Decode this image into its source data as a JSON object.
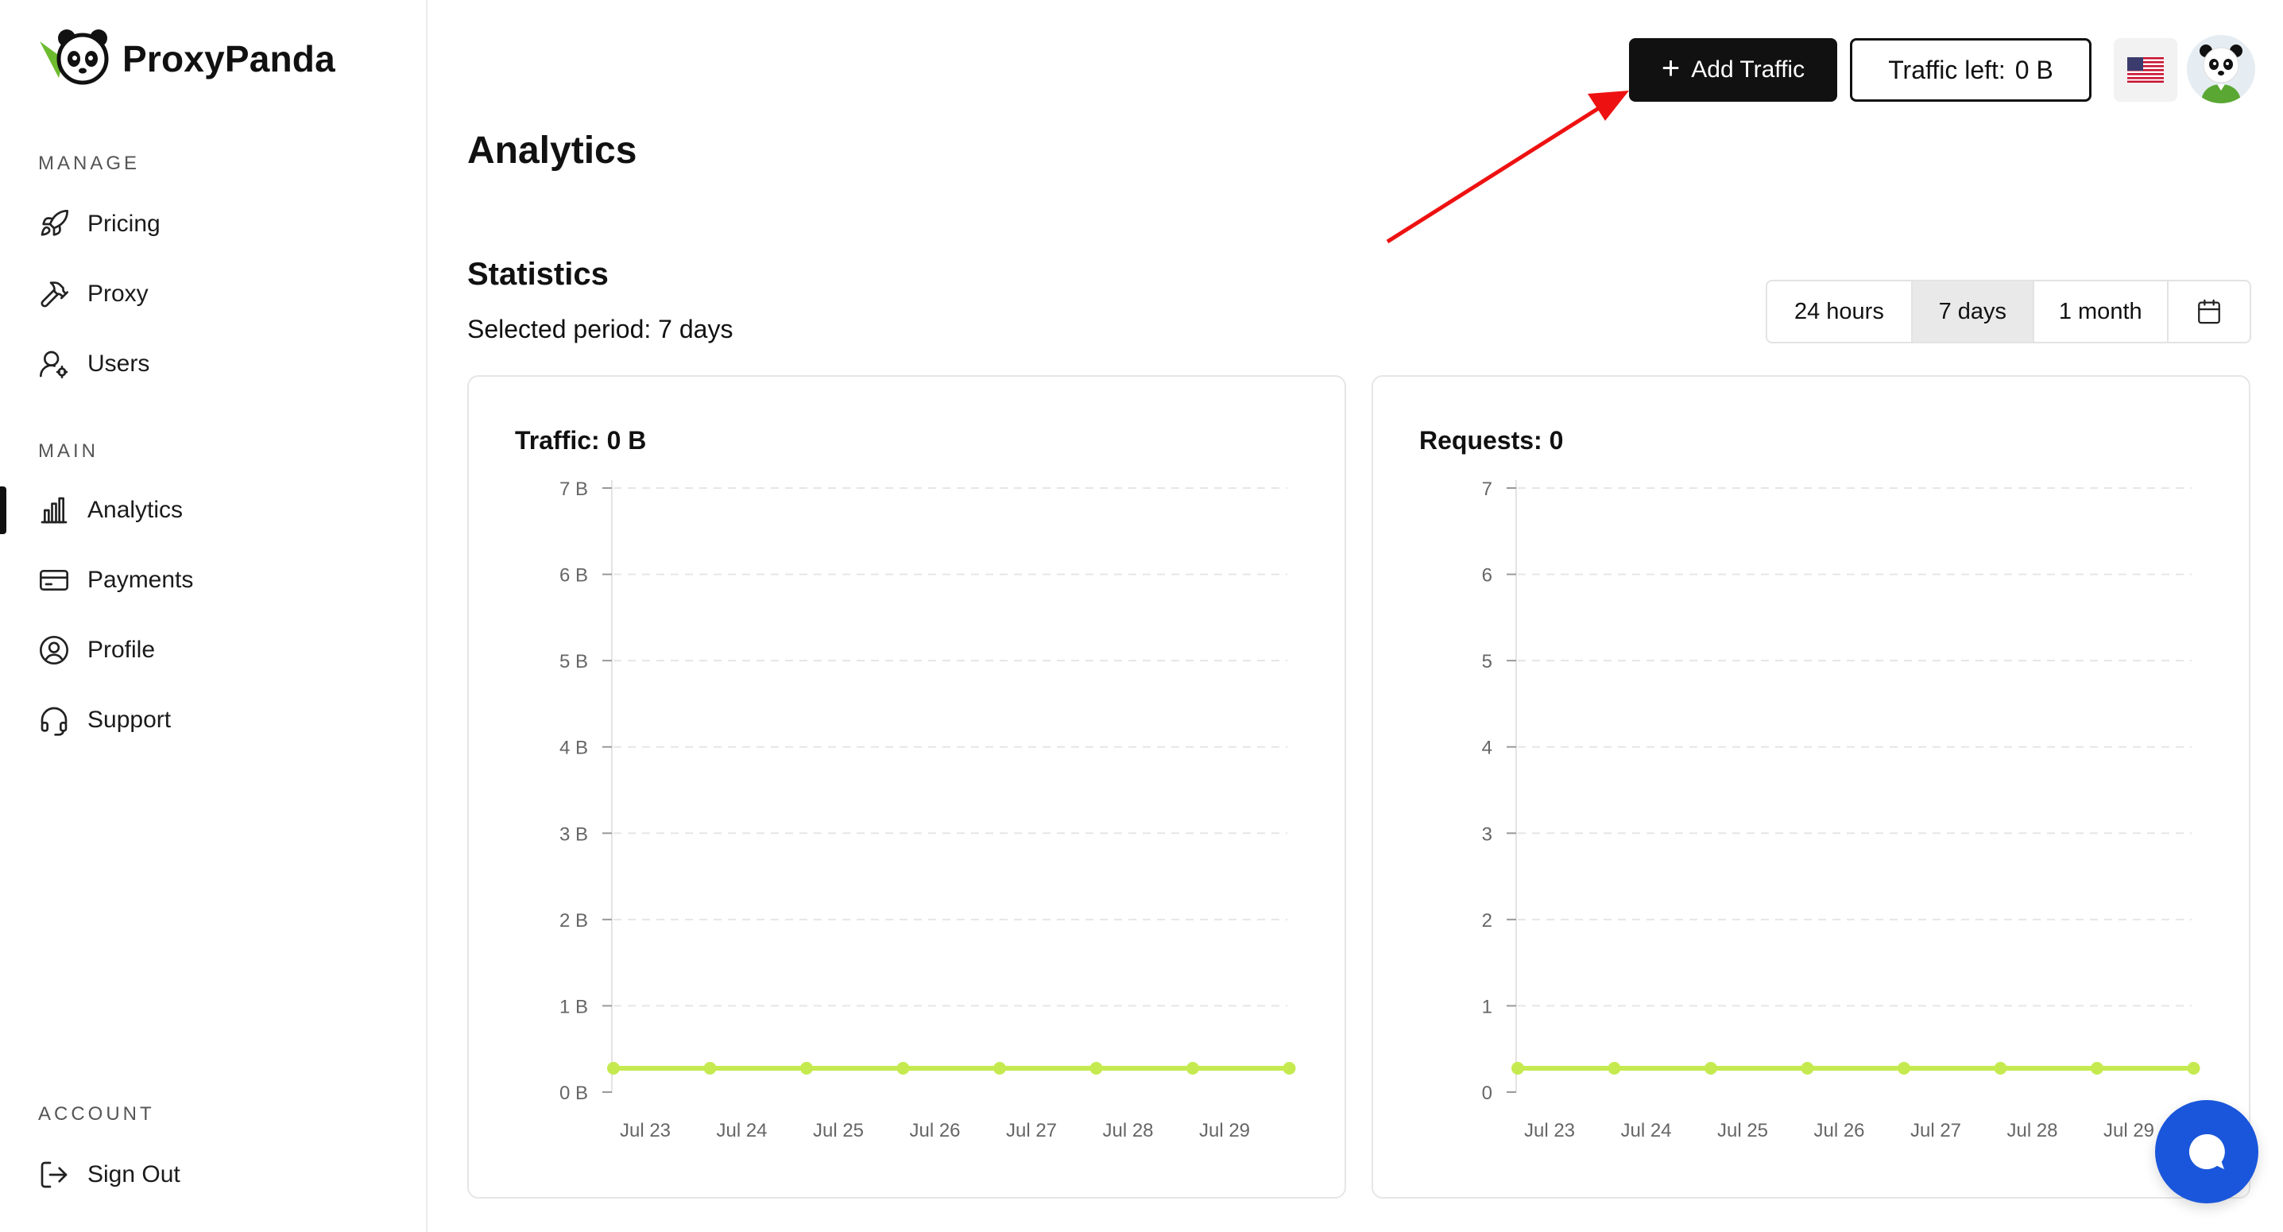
{
  "brand": {
    "name": "ProxyPanda"
  },
  "sidebar": {
    "manage_label": "MANAGE",
    "main_label": "MAIN",
    "account_label": "ACCOUNT",
    "manage_items": [
      {
        "label": "Pricing",
        "icon": "rocket-icon"
      },
      {
        "label": "Proxy",
        "icon": "hammer-icon"
      },
      {
        "label": "Users",
        "icon": "user-gear-icon"
      }
    ],
    "main_items": [
      {
        "label": "Analytics",
        "icon": "bar-chart-icon",
        "active": true
      },
      {
        "label": "Payments",
        "icon": "credit-card-icon"
      },
      {
        "label": "Profile",
        "icon": "user-circle-icon"
      },
      {
        "label": "Support",
        "icon": "headset-icon"
      }
    ],
    "account_items": [
      {
        "label": "Sign Out",
        "icon": "sign-out-icon"
      }
    ]
  },
  "header": {
    "add_traffic_label": "Add Traffic",
    "traffic_left_label": "Traffic left:",
    "traffic_left_value": "0 B",
    "language_icon": "us-flag-icon"
  },
  "page": {
    "title": "Analytics",
    "statistics_title": "Statistics",
    "selected_period": "Selected period: 7 days"
  },
  "range_options": [
    {
      "label": "24 hours",
      "selected": false
    },
    {
      "label": "7 days",
      "selected": true
    },
    {
      "label": "1 month",
      "selected": false
    },
    {
      "label": "",
      "icon": "calendar-icon",
      "selected": false
    }
  ],
  "chart_data": [
    {
      "type": "line",
      "title": "Traffic: 0 B",
      "x": [
        "Jul 23",
        "Jul 24",
        "Jul 25",
        "Jul 26",
        "Jul 27",
        "Jul 28",
        "Jul 29",
        ""
      ],
      "x_tick_labels": [
        "Jul 23",
        "Jul 24",
        "Jul 25",
        "Jul 26",
        "Jul 27",
        "Jul 28",
        "Jul 29"
      ],
      "y_ticks": [
        "0 B",
        "1 B",
        "2 B",
        "3 B",
        "4 B",
        "5 B",
        "6 B",
        "7 B"
      ],
      "ylim": [
        0,
        7
      ],
      "series": [
        {
          "values": [
            0,
            0,
            0,
            0,
            0,
            0,
            0,
            0
          ],
          "color": "#c5ea4f"
        }
      ],
      "grid": true
    },
    {
      "type": "line",
      "title": "Requests: 0",
      "x": [
        "Jul 23",
        "Jul 24",
        "Jul 25",
        "Jul 26",
        "Jul 27",
        "Jul 28",
        "Jul 29",
        ""
      ],
      "x_tick_labels": [
        "Jul 23",
        "Jul 24",
        "Jul 25",
        "Jul 26",
        "Jul 27",
        "Jul 28",
        "Jul 29"
      ],
      "y_ticks": [
        "0",
        "1",
        "2",
        "3",
        "4",
        "5",
        "6",
        "7"
      ],
      "ylim": [
        0,
        7
      ],
      "series": [
        {
          "values": [
            0,
            0,
            0,
            0,
            0,
            0,
            0,
            0
          ],
          "color": "#c5ea4f"
        }
      ],
      "grid": true
    }
  ],
  "colors": {
    "accent": "#c5ea4f",
    "primary": "#111111",
    "chat": "#1a56db",
    "annotation_arrow": "#ee1111"
  }
}
